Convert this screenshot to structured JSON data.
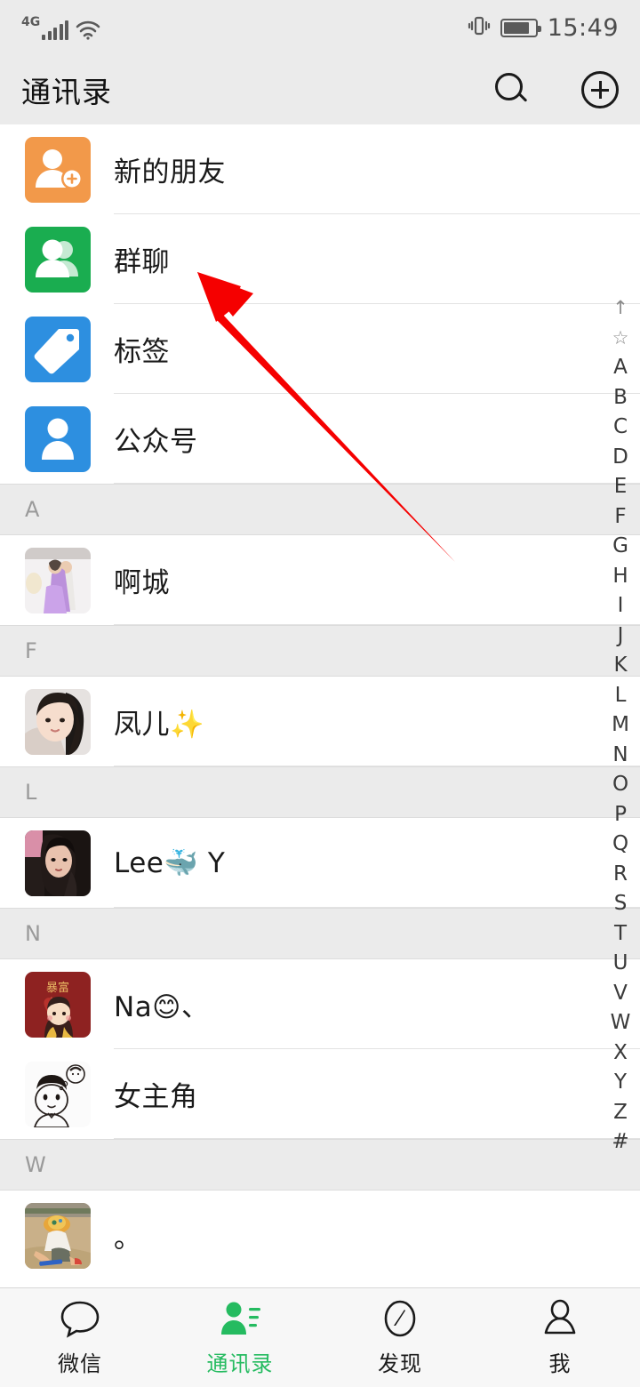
{
  "status_bar": {
    "network_label": "4G",
    "signal_icon": "signal-bars-icon",
    "wifi_icon": "wifi-icon",
    "vibrate_icon": "vibrate-icon",
    "battery_icon": "battery-icon",
    "time": "15:49"
  },
  "header": {
    "title": "通讯录",
    "search_icon": "search-icon",
    "add_icon": "plus-circle-icon"
  },
  "function_entries": [
    {
      "label": "新的朋友",
      "icon": "new-friend-icon",
      "color": "#f2994a"
    },
    {
      "label": "群聊",
      "icon": "group-chat-icon",
      "color": "#1aad50"
    },
    {
      "label": "标签",
      "icon": "tag-icon",
      "color": "#2d8fe0"
    },
    {
      "label": "公众号",
      "icon": "official-account-icon",
      "color": "#2d8fe0"
    }
  ],
  "sections": [
    {
      "letter": "A",
      "contacts": [
        {
          "name": "啊城",
          "avatar": "wedding-couple-photo"
        }
      ]
    },
    {
      "letter": "F",
      "contacts": [
        {
          "name": "凤儿✨",
          "avatar": "young-woman-selfie-photo"
        }
      ]
    },
    {
      "letter": "L",
      "contacts": [
        {
          "name": "Lee🐳 Y",
          "avatar": "woman-portrait-photo"
        }
      ]
    },
    {
      "letter": "N",
      "contacts": [
        {
          "name": "Na😊、",
          "avatar": "red-cartoon-girl-avatar"
        },
        {
          "name": "女主角",
          "avatar": "cartoon-boy-sketch-avatar"
        }
      ]
    },
    {
      "letter": "W",
      "contacts": [
        {
          "name": "。",
          "avatar": "child-on-beach-photo"
        }
      ]
    }
  ],
  "index_bar": {
    "items": [
      "↑",
      "☆",
      "A",
      "B",
      "C",
      "D",
      "E",
      "F",
      "G",
      "H",
      "I",
      "J",
      "K",
      "L",
      "M",
      "N",
      "O",
      "P",
      "Q",
      "R",
      "S",
      "T",
      "U",
      "V",
      "W",
      "X",
      "Y",
      "Z",
      "#"
    ]
  },
  "tabbar": {
    "active_color": "#25bb60",
    "tabs": [
      {
        "label": "微信",
        "icon": "chat-bubble-icon",
        "active": false
      },
      {
        "label": "通讯录",
        "icon": "contacts-icon",
        "active": true
      },
      {
        "label": "发现",
        "icon": "compass-icon",
        "active": false
      },
      {
        "label": "我",
        "icon": "person-icon",
        "active": false
      }
    ]
  },
  "annotation": {
    "arrow_color": "#f50000",
    "arrow_icon": "red-pointer-arrow",
    "points_at": "群聊"
  }
}
